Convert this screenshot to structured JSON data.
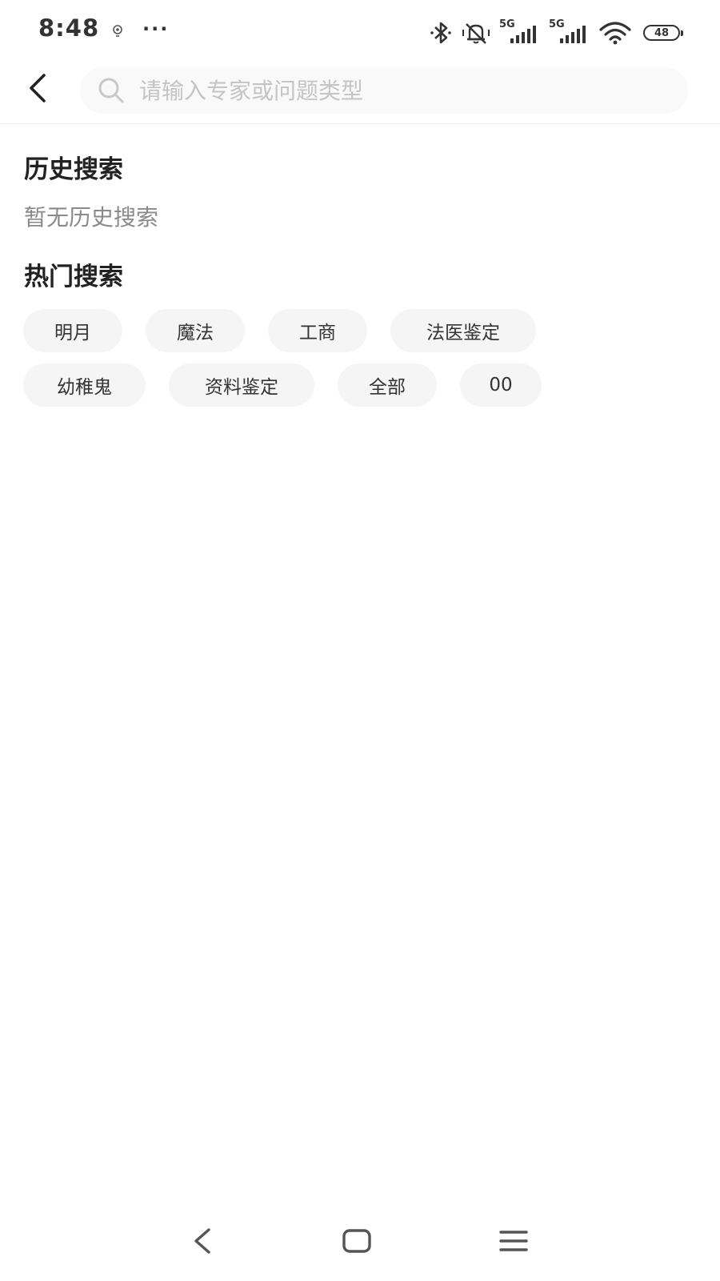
{
  "status_bar": {
    "time": "8:48",
    "dots": "···",
    "signal1_label": "5G",
    "signal2_label": "5G",
    "battery": "48"
  },
  "header": {
    "search_placeholder": "请输入专家或问题类型"
  },
  "history": {
    "title": "历史搜索",
    "empty_text": "暂无历史搜索"
  },
  "hot": {
    "title": "热门搜索",
    "row1": [
      "明月",
      "魔法",
      "工商",
      "法医鉴定"
    ],
    "row2": [
      "幼稚鬼",
      "资料鉴定",
      "全部",
      "00"
    ]
  },
  "colors": {
    "chip_bg": "#f5f5f5",
    "placeholder": "#c4c4c4",
    "muted_text": "#8a8a8a"
  }
}
